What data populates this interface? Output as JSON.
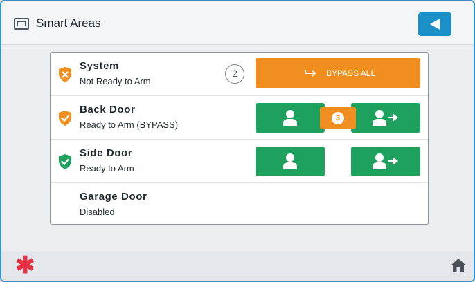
{
  "header": {
    "title": "Smart Areas",
    "panel_icon": "security-panel-icon",
    "back_icon": "back-arrow-icon"
  },
  "rows": [
    {
      "title": "System",
      "status": "Not Ready to Arm",
      "shield": "shield-x-icon",
      "shield_color": "#f08f1f",
      "count": "2",
      "bypass_label": "BYPASS ALL"
    },
    {
      "title": "Back Door",
      "status": "Ready to Arm (BYPASS)",
      "shield": "shield-check-icon",
      "shield_color": "#f08f1f",
      "badge_count": "3"
    },
    {
      "title": "Side Door",
      "status": "Ready to Arm",
      "shield": "shield-check-icon",
      "shield_color": "#1ea05f"
    },
    {
      "title": "Garage Door",
      "status": "Disabled"
    }
  ],
  "footer": {
    "emergency_symbol": "✱",
    "home_icon": "home-icon"
  },
  "colors": {
    "accent_blue": "#1b8fc7",
    "orange": "#f08f1f",
    "green": "#1ea05f",
    "emergency_red": "#e63343",
    "frame_blue": "#2d8fd4"
  }
}
